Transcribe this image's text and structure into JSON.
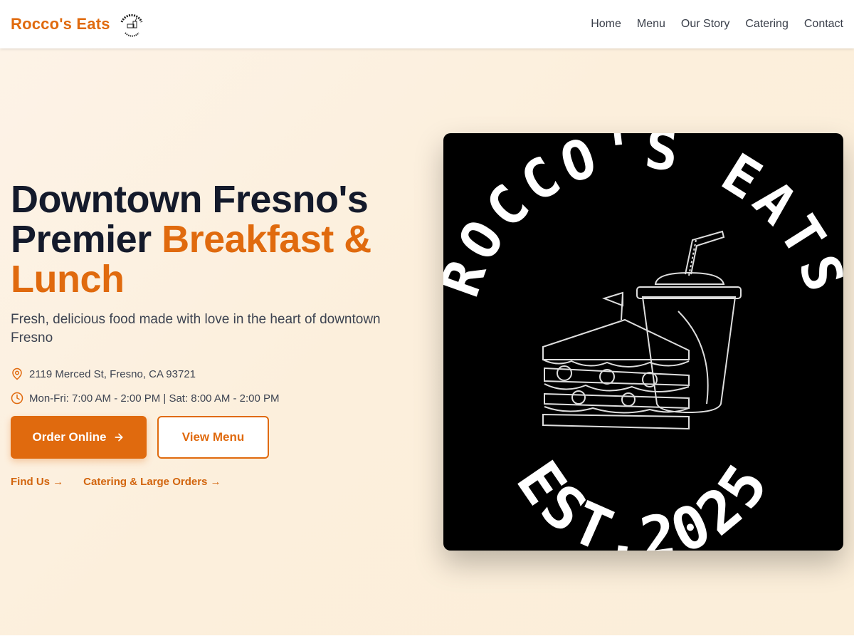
{
  "nav": {
    "brand": "Rocco's Eats",
    "logo_icon": "roccos-eats-logo-icon",
    "links": [
      "Home",
      "Menu",
      "Our Story",
      "Catering",
      "Contact"
    ]
  },
  "hero": {
    "headline_line1": "Downtown Fresno's",
    "headline_line2_plain": "Premier ",
    "headline_line2_accent": "Breakfast &",
    "headline_line3_accent": "Lunch",
    "subtitle": "Fresh, delicious food made with love in the heart of downtown Fresno",
    "address": "2119 Merced St, Fresno, CA 93721",
    "hours": "Mon-Fri: 7:00 AM - 2:00 PM | Sat: 8:00 AM - 2:00 PM",
    "order_button": "Order Online",
    "menu_button": "View Menu",
    "find_us_link": "Find Us →",
    "catering_link": "Catering & Large Orders →"
  },
  "colors": {
    "accent": "#e06a0e",
    "text": "#141a2b",
    "background": "#fbf0df"
  }
}
